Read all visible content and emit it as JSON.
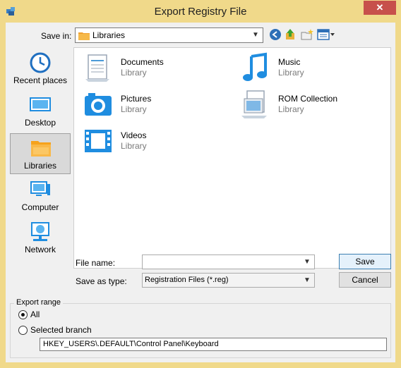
{
  "window": {
    "title": "Export Registry File",
    "close_label": "✕"
  },
  "toolbar": {
    "save_in_label": "Save in:",
    "save_in_value": "Libraries"
  },
  "places": [
    {
      "label": "Recent places",
      "icon": "clock-icon"
    },
    {
      "label": "Desktop",
      "icon": "desktop-icon"
    },
    {
      "label": "Libraries",
      "icon": "libraries-icon",
      "selected": true
    },
    {
      "label": "Computer",
      "icon": "computer-icon"
    },
    {
      "label": "Network",
      "icon": "network-icon"
    }
  ],
  "libraries": [
    {
      "name": "Documents",
      "sub": "Library",
      "icon": "documents-icon"
    },
    {
      "name": "Music",
      "sub": "Library",
      "icon": "music-icon"
    },
    {
      "name": "Pictures",
      "sub": "Library",
      "icon": "pictures-icon"
    },
    {
      "name": "ROM Collection",
      "sub": "Library",
      "icon": "rom-collection-icon"
    },
    {
      "name": "Videos",
      "sub": "Library",
      "icon": "videos-icon"
    }
  ],
  "form": {
    "file_name_label": "File name:",
    "file_name_value": "",
    "save_type_label": "Save as type:",
    "save_type_value": "Registration Files (*.reg)",
    "save_button": "Save",
    "cancel_button": "Cancel"
  },
  "export_range": {
    "title": "Export range",
    "all_label": "All",
    "all_selected": true,
    "selected_branch_label": "Selected branch",
    "branch_value": "HKEY_USERS\\.DEFAULT\\Control Panel\\Keyboard"
  },
  "colors": {
    "accent": "#1f8de0",
    "titlebar": "#f0d98a",
    "close": "#c7504b"
  }
}
